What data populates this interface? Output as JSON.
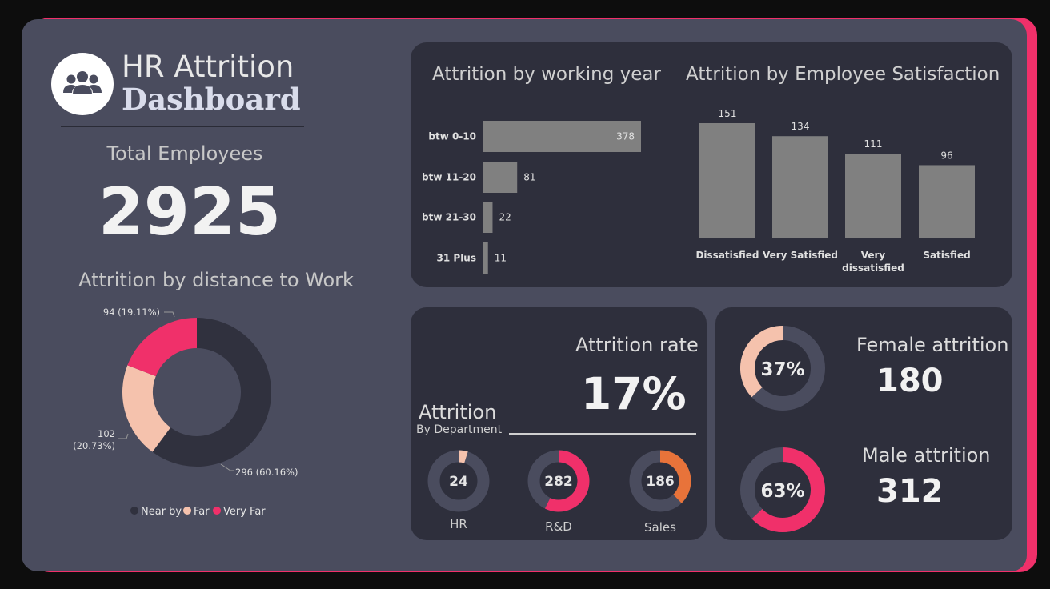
{
  "colors": {
    "background": "#0d0d0d",
    "canvas": "#4a4c5e",
    "panel": "#2e2f3c",
    "accent": "#f0306a",
    "bar": "#808080",
    "near": "#30313e",
    "far": "#f5c2ad",
    "very_far": "#f0306a",
    "sales": "#e8733a",
    "track": "#4a4c5e"
  },
  "header": {
    "title_line1": "HR Attrition",
    "title_line2": "Dashboard",
    "logo_icon": "people-group-icon"
  },
  "total": {
    "label": "Total Employees",
    "value": "2925"
  },
  "distance_chart": {
    "title": "Attrition by distance to Work",
    "chart_data": {
      "type": "pie",
      "categories": [
        "Near by",
        "Far",
        "Very Far"
      ],
      "values": [
        296,
        102,
        94
      ],
      "percent_labels": [
        "296 (60.16%)",
        "102 (20.73%)",
        "94 (19.11%)"
      ],
      "far_label_lines": [
        "102",
        "(20.73%)"
      ],
      "legend": "bottom"
    }
  },
  "working_year_chart": {
    "title": "Attrition by working year",
    "chart_data": {
      "type": "bar",
      "orientation": "horizontal",
      "categories": [
        "btw 0-10",
        "btw 11-20",
        "btw 21-30",
        "31 Plus"
      ],
      "values": [
        378,
        81,
        22,
        11
      ]
    }
  },
  "satisfaction_chart": {
    "title": "Attrition by Employee Satisfaction",
    "chart_data": {
      "type": "bar",
      "categories": [
        "Dissatisfied",
        "Very Satisfied",
        "Very dissatisfied",
        "Satisfied"
      ],
      "category_lines": [
        [
          "Dissatisfied"
        ],
        [
          "Very Satisfied"
        ],
        [
          "Very",
          "dissatisfied"
        ],
        [
          "Satisfied"
        ]
      ],
      "values": [
        151,
        134,
        111,
        96
      ]
    }
  },
  "rate": {
    "label": "Attrition rate",
    "value": "17%"
  },
  "department": {
    "title": "Attrition",
    "subtitle": "By Department",
    "items": [
      {
        "name": "HR",
        "value": "24",
        "fraction": 0.049
      },
      {
        "name": "R&D",
        "value": "282",
        "fraction": 0.573
      },
      {
        "name": "Sales",
        "value": "186",
        "fraction": 0.378
      }
    ]
  },
  "gender": {
    "female": {
      "label": "Female attrition",
      "value": "180",
      "percent": "37%",
      "fraction": 0.37
    },
    "male": {
      "label": "Male attrition",
      "value": "312",
      "percent": "63%",
      "fraction": 0.63
    }
  }
}
